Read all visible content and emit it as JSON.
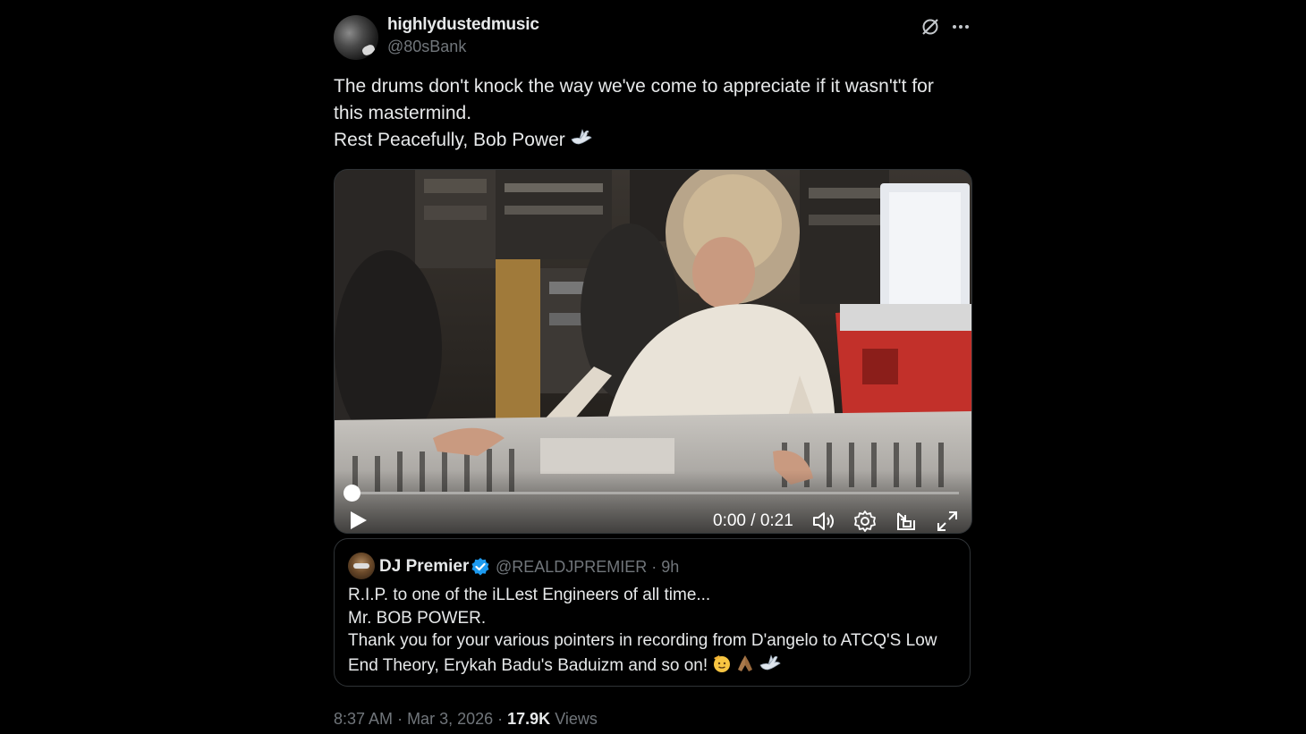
{
  "author": {
    "display_name": "highlydustedmusic",
    "handle": "@80sBank"
  },
  "tweet": {
    "lines": [
      "The drums don't knock the way we've come to appreciate if it wasn't't for",
      "this mastermind.",
      "Rest Peacefully, Bob Power"
    ],
    "trailing_emoji": "dove-icon"
  },
  "video": {
    "time": "0:00 / 0:21",
    "progress_fraction": 0.0
  },
  "quote": {
    "display_name": "DJ Premier",
    "meta": "@REALDJPREMIER · 9h",
    "lines": [
      "R.I.P. to one of the iLLest Engineers of all time...",
      "Mr. BOB POWER.",
      "Thank you for your various pointers in recording from D'angelo to ATCQ'S Low",
      "End Theory, Erykah Badu's Baduizm and so on!"
    ],
    "emojis": [
      "saluting-face-icon",
      "folded-hands-icon",
      "dove-icon"
    ]
  },
  "footer": {
    "time": "8:37 AM",
    "date": "Mar 3, 2026",
    "views_count": "17.9K",
    "views_label": "Views"
  },
  "colors": {
    "background": "#000000",
    "text": "#e7e9ea",
    "secondary_text": "#71767b",
    "border": "#2f3336",
    "verified_blue": "#1d9bf0"
  }
}
